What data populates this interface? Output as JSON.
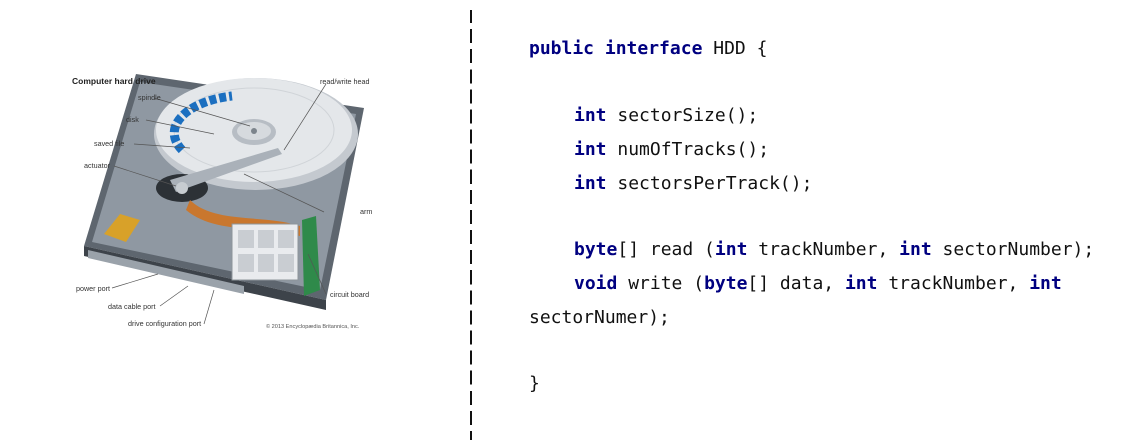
{
  "figure": {
    "title": "Computer hard drive",
    "labels": {
      "spindle": "spindle",
      "disk": "disk",
      "saved_file": "saved file",
      "actuator": "actuator",
      "read_write_head": "read/write head",
      "arm": "arm",
      "power_port": "power port",
      "data_cable_port": "data cable port",
      "drive_configuration_port": "drive configuration port",
      "circuit_board": "circuit board"
    },
    "copyright": "© 2013 Encyclopædia Britannica, Inc.",
    "colors": {
      "platter": "#d9dde2",
      "case": "#6f7780",
      "file_track": "#1b6fc0",
      "flex_cable": "#c9772e",
      "board": "#2f8a4a"
    }
  },
  "code": {
    "line1": {
      "kw1": "public",
      "kw2": "interface",
      "rest": " HDD {"
    },
    "line2": {
      "kw": "int",
      "rest": " sectorSize();"
    },
    "line3": {
      "kw": "int",
      "rest": " numOfTracks();"
    },
    "line4": {
      "kw": "int",
      "rest": " sectorsPerTrack();"
    },
    "line5": {
      "kw1": "byte",
      "t1": "[] read (",
      "kw2": "int",
      "t2": " trackNumber, ",
      "kw3": "int",
      "t3": " sectorNumber);"
    },
    "line6": {
      "kw1": "void",
      "t1": " write (",
      "kw2": "byte",
      "t2": "[] data, ",
      "kw3": "int",
      "t3": " trackNumber, ",
      "kw4": "int"
    },
    "line7": {
      "text": "sectorNumer);"
    },
    "line8": {
      "text": "}"
    }
  }
}
